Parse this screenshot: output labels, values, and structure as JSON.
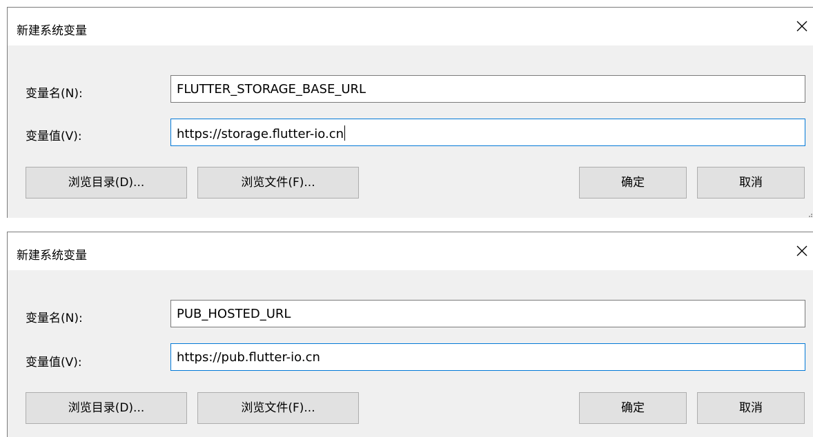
{
  "dialogs": [
    {
      "title": "新建系统变量",
      "name_label": "变量名(N):",
      "name_value": "FLUTTER_STORAGE_BASE_URL",
      "value_label": "变量值(V):",
      "value_value": "https://storage.flutter-io.cn",
      "browse_dir_label": "浏览目录(D)...",
      "browse_file_label": "浏览文件(F)...",
      "ok_label": "确定",
      "cancel_label": "取消",
      "close_icon": "close-icon"
    },
    {
      "title": "新建系统变量",
      "name_label": "变量名(N):",
      "name_value": "PUB_HOSTED_URL",
      "value_label": "变量值(V):",
      "value_value": "https://pub.flutter-io.cn",
      "browse_dir_label": "浏览目录(D)...",
      "browse_file_label": "浏览文件(F)...",
      "ok_label": "确定",
      "cancel_label": "取消",
      "close_icon": "close-icon"
    }
  ],
  "colors": {
    "dialog_bg": "#f0f0f0",
    "titlebar_bg": "#ffffff",
    "field_border": "#7a7a7a",
    "focus_border": "#0078d7",
    "button_bg": "#e1e1e1",
    "button_border": "#adadad"
  }
}
